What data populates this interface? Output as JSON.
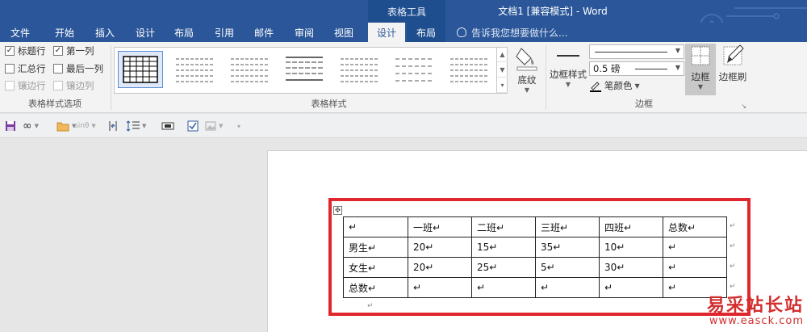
{
  "titlebar": {
    "context_tools": "表格工具",
    "doc_title": "文档1 [兼容模式] - Word"
  },
  "tabs": [
    {
      "label": "文件"
    },
    {
      "label": "开始"
    },
    {
      "label": "插入"
    },
    {
      "label": "设计"
    },
    {
      "label": "布局"
    },
    {
      "label": "引用"
    },
    {
      "label": "邮件"
    },
    {
      "label": "审阅"
    },
    {
      "label": "视图"
    },
    {
      "label": "设计"
    },
    {
      "label": "布局"
    }
  ],
  "tell_me": "告诉我您想要做什么...",
  "ribbon": {
    "style_options": {
      "header_row": "标题行",
      "first_column": "第一列",
      "total_row": "汇总行",
      "last_column": "最后一列",
      "banded_rows": "镶边行",
      "banded_columns": "镶边列",
      "group_label": "表格样式选项"
    },
    "table_styles": {
      "group_label": "表格样式",
      "shading": "底纹"
    },
    "borders": {
      "border_styles": "边框样式",
      "weight": "0.5 磅",
      "pen_color": "笔颜色",
      "borders": "边框",
      "border_painter": "边框刷",
      "group_label": "边框"
    }
  },
  "qat": {
    "infinity": "∞",
    "equation": "sinθ"
  },
  "table": {
    "rows": [
      [
        "↵",
        "一班↵",
        "二班↵",
        "三班↵",
        "四班↵",
        "总数↵"
      ],
      [
        "男生↵",
        "20↵",
        "15↵",
        "35↵",
        "10↵",
        "↵"
      ],
      [
        "女生↵",
        "20↵",
        "25↵",
        "5↵",
        "30↵",
        "↵"
      ],
      [
        "总数↵",
        "↵",
        "↵",
        "↵",
        "↵",
        "↵"
      ]
    ],
    "after_mark": "↵"
  },
  "watermark": {
    "cn": "易采站长站",
    "url": "www.easck.com"
  },
  "colors": {
    "brand": "#2b579a",
    "highlight_frame": "#e1262d"
  }
}
